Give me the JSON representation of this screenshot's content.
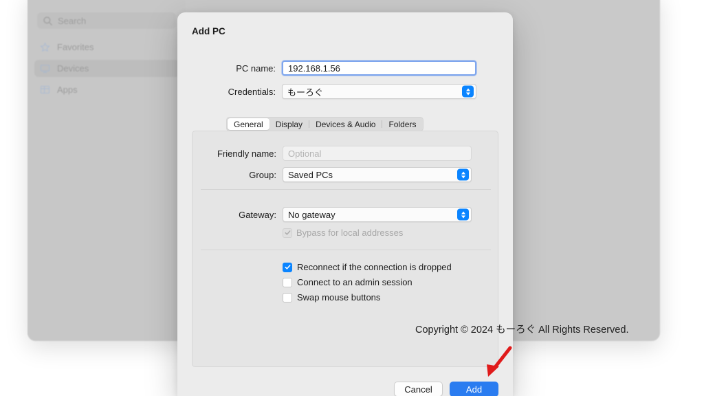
{
  "background_window": {
    "search": {
      "placeholder": "Search",
      "icon": "search-icon"
    },
    "sidebar": {
      "items": [
        {
          "label": "Favorites",
          "icon": "star-icon",
          "selected": false
        },
        {
          "label": "Devices",
          "icon": "monitor-icon",
          "selected": true
        },
        {
          "label": "Apps",
          "icon": "grid-icon",
          "selected": false
        }
      ]
    }
  },
  "dialog": {
    "title": "Add PC",
    "fields": {
      "pc_name_label": "PC name:",
      "pc_name_value": "192.168.1.56",
      "credentials_label": "Credentials:",
      "credentials_value": "もーろぐ"
    },
    "tabs": [
      {
        "label": "General",
        "active": true
      },
      {
        "label": "Display",
        "active": false
      },
      {
        "label": "Devices & Audio",
        "active": false
      },
      {
        "label": "Folders",
        "active": false
      }
    ],
    "general": {
      "friendly_name_label": "Friendly name:",
      "friendly_name_value": "",
      "friendly_name_placeholder": "Optional",
      "group_label": "Group:",
      "group_value": "Saved PCs",
      "gateway_label": "Gateway:",
      "gateway_value": "No gateway",
      "bypass": {
        "label": "Bypass for local addresses",
        "checked": true,
        "disabled": true
      },
      "options": [
        {
          "label": "Reconnect if the connection is dropped",
          "checked": true
        },
        {
          "label": "Connect to an admin session",
          "checked": false
        },
        {
          "label": "Swap mouse buttons",
          "checked": false
        }
      ]
    },
    "buttons": {
      "cancel": "Cancel",
      "add": "Add"
    }
  },
  "watermark": {
    "copyright": "Copyright © 2024 もーろぐ All Rights Reserved."
  },
  "annotation": {
    "arrow_color": "#e01b1b",
    "points_to": "Add"
  },
  "colors": {
    "accent_blue": "#0a84ff",
    "button_blue": "#2a7cf0",
    "dialog_bg": "#ececec",
    "panel_bg": "#e5e5e5",
    "arrow_red": "#e01b1b"
  }
}
